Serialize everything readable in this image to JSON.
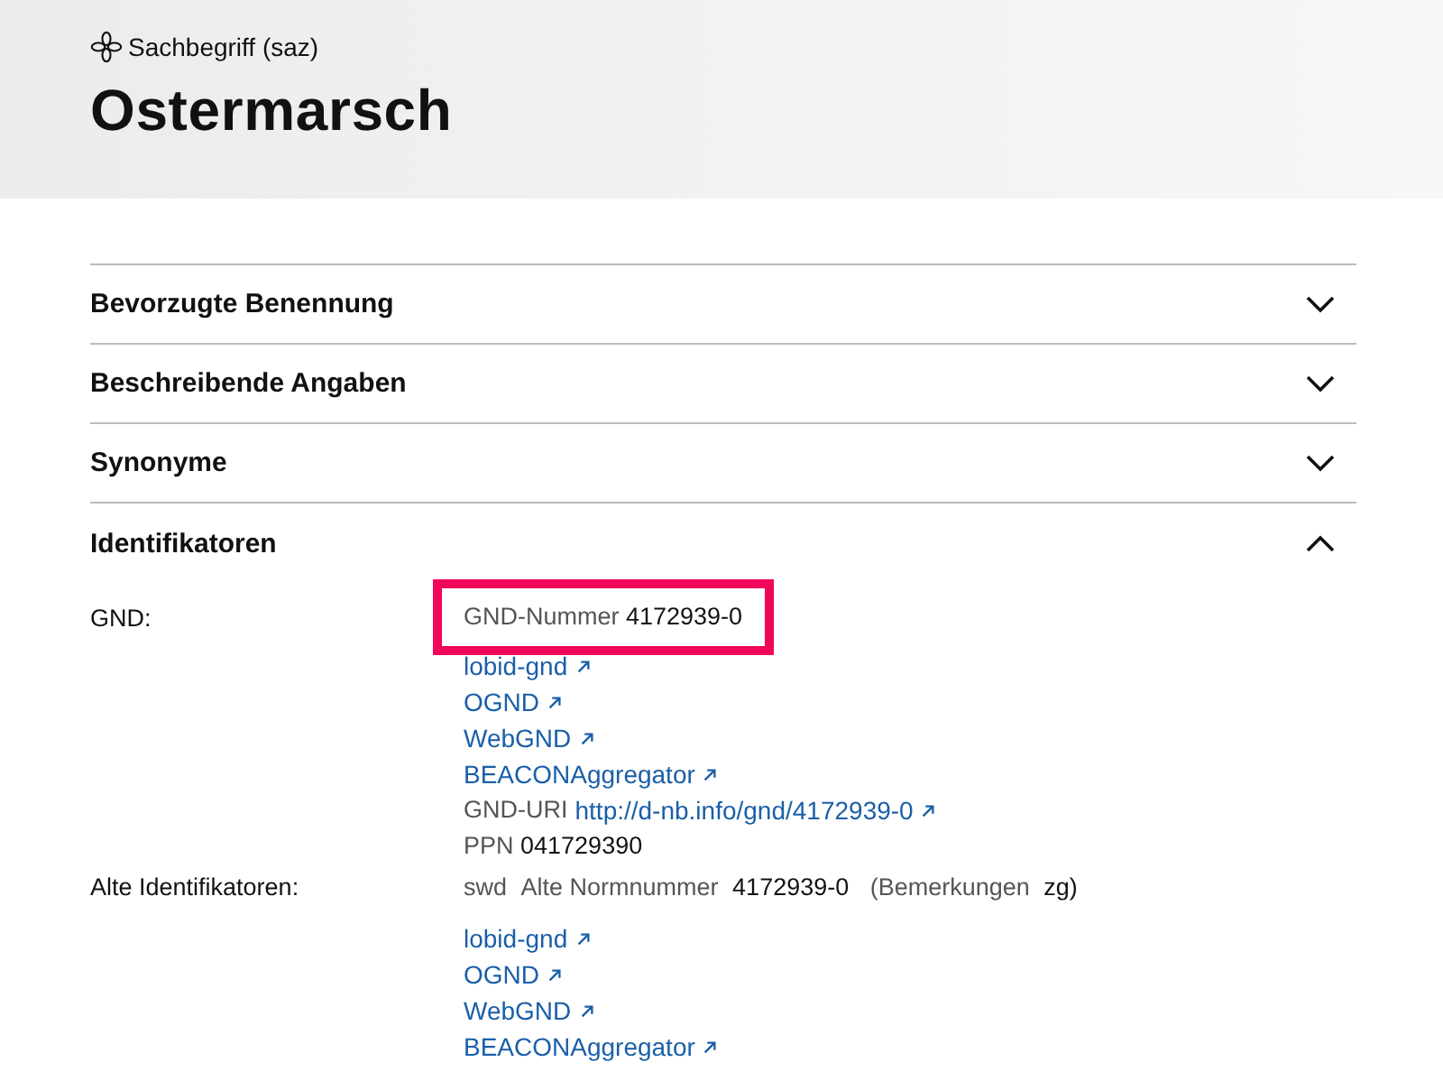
{
  "header": {
    "type": "Sachbegriff (saz)",
    "title": "Ostermarsch"
  },
  "sections": [
    {
      "title": "Bevorzugte Benennung",
      "expanded": false
    },
    {
      "title": "Beschreibende Angaben",
      "expanded": false
    },
    {
      "title": "Synonyme",
      "expanded": false
    },
    {
      "title": "Identifikatoren",
      "expanded": true
    }
  ],
  "identifiers": [
    {
      "label": "GND:",
      "lines": [
        {
          "kind": "field",
          "name": "GND-Nummer",
          "value": "4172939-0",
          "highlighted": true
        },
        {
          "kind": "link",
          "text": "lobid-gnd"
        },
        {
          "kind": "link",
          "text": "OGND"
        },
        {
          "kind": "link",
          "text": "WebGND"
        },
        {
          "kind": "link",
          "text": "BEACONAggregator"
        },
        {
          "kind": "field_link",
          "name": "GND-URI",
          "value": "http://d-nb.info/gnd/4172939-0"
        },
        {
          "kind": "field",
          "name": "PPN",
          "value": "041729390",
          "highlighted": false
        }
      ]
    },
    {
      "label": "Alte Identifikatoren:",
      "lines": [
        {
          "kind": "old",
          "source": "swd",
          "name": "Alte Normnummer",
          "value": "4172939-0",
          "remark_label": "(Bemerkungen",
          "remark": "zg)"
        },
        {
          "kind": "link",
          "text": "lobid-gnd"
        },
        {
          "kind": "link",
          "text": "OGND"
        },
        {
          "kind": "link",
          "text": "WebGND"
        },
        {
          "kind": "link",
          "text": "BEACONAggregator"
        }
      ]
    }
  ]
}
